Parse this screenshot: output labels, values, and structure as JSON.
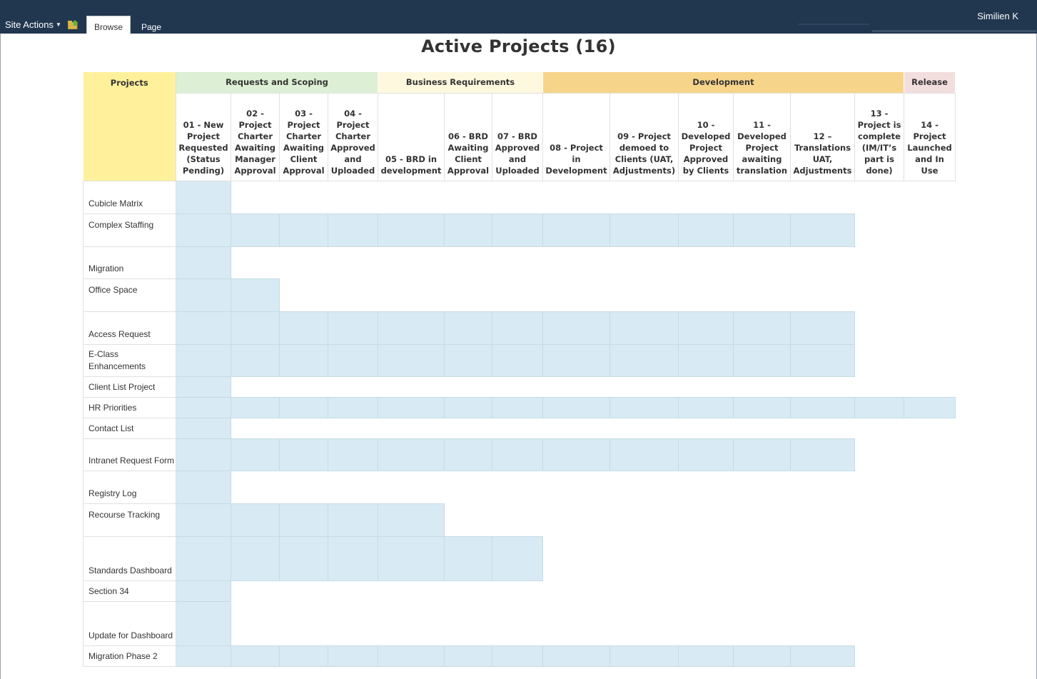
{
  "topbar": {
    "site_actions": "Site Actions",
    "tabs": [
      "Browse",
      "Page"
    ],
    "user": "Similien K"
  },
  "title": "Active Projects (16)",
  "phases": [
    {
      "label": "Projects",
      "color": "#fff19b"
    },
    {
      "label": "Requests and Scoping",
      "color": "#ddefd4"
    },
    {
      "label": "Business Requirements",
      "color": "#fef8df"
    },
    {
      "label": "Development",
      "color": "#f6d48a"
    },
    {
      "label": "Release",
      "color": "#f2dedd"
    }
  ],
  "stages": [
    "01 - New Project Requested (Status Pending)",
    "02 - Project Charter Awaiting Manager Approval",
    "03 - Project Charter Awaiting Client Approval",
    "04 - Project Charter Approved and Uploaded",
    "05 - BRD in development",
    "06 - BRD Awaiting Client Approval",
    "07 - BRD Approved and Uploaded",
    "08 - Project in Development",
    "09 - Project demoed to Clients (UAT, Adjustments)",
    "10 - Developed Project Approved by Clients",
    "11 - Developed Project awaiting translation",
    "12 – Translations UAT, Adjustments",
    "13 - Project is complete (IM/IT’s part is done)",
    "14 - Project Launched and In Use"
  ],
  "projects": [
    {
      "name": "Cubicle Matrix",
      "progress": 1
    },
    {
      "name": "Complex Staffing",
      "progress": 12
    },
    {
      "name": "Migration",
      "progress": 1
    },
    {
      "name": "Office Space",
      "progress": 2
    },
    {
      "name": "Access Request",
      "progress": 12
    },
    {
      "name": "E-Class Enhancements",
      "progress": 12
    },
    {
      "name": "Client List Project",
      "progress": 1
    },
    {
      "name": "HR Priorities",
      "progress": 14
    },
    {
      "name": "Contact List",
      "progress": 1
    },
    {
      "name": "Intranet Request Form",
      "progress": 12
    },
    {
      "name": "Registry Log",
      "progress": 1
    },
    {
      "name": "Recourse Tracking",
      "progress": 5
    },
    {
      "name": "Standards Dashboard",
      "progress": 7
    },
    {
      "name": "Section 34",
      "progress": 1
    },
    {
      "name": "Update for Dashboard",
      "progress": 1
    },
    {
      "name": "Migration Phase 2",
      "progress": 12
    }
  ]
}
